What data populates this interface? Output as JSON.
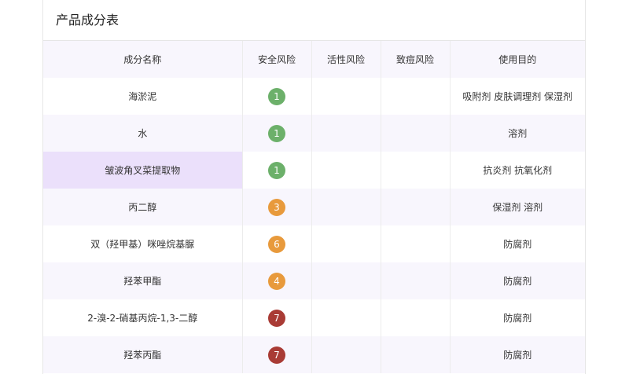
{
  "title": "产品成分表",
  "columns": [
    "成分名称",
    "安全风险",
    "活性风险",
    "致痘风险",
    "使用目的"
  ],
  "colors": {
    "low": "#6cb06a",
    "medium": "#e89a3c",
    "high": "#a93b35"
  },
  "rows": [
    {
      "name": "海淤泥",
      "safety": "1",
      "level": "low",
      "active": "",
      "acne": "",
      "purpose": "吸附剂 皮肤调理剂 保湿剂"
    },
    {
      "name": "水",
      "safety": "1",
      "level": "low",
      "active": "",
      "acne": "",
      "purpose": "溶剂"
    },
    {
      "name": "皱波角叉菜提取物",
      "safety": "1",
      "level": "low",
      "active": "",
      "acne": "",
      "purpose": "抗炎剂 抗氧化剂",
      "highlight": true
    },
    {
      "name": "丙二醇",
      "safety": "3",
      "level": "medium",
      "active": "",
      "acne": "",
      "purpose": "保湿剂 溶剂"
    },
    {
      "name": "双（羟甲基）咪唑烷基脲",
      "safety": "6",
      "level": "medium",
      "active": "",
      "acne": "",
      "purpose": "防腐剂"
    },
    {
      "name": "羟苯甲酯",
      "safety": "4",
      "level": "medium",
      "active": "",
      "acne": "",
      "purpose": "防腐剂"
    },
    {
      "name": "2-溴-2-硝基丙烷-1,3-二醇",
      "safety": "7",
      "level": "high",
      "active": "",
      "acne": "",
      "purpose": "防腐剂"
    },
    {
      "name": "羟苯丙酯",
      "safety": "7",
      "level": "high",
      "active": "",
      "acne": "",
      "purpose": "防腐剂"
    }
  ]
}
